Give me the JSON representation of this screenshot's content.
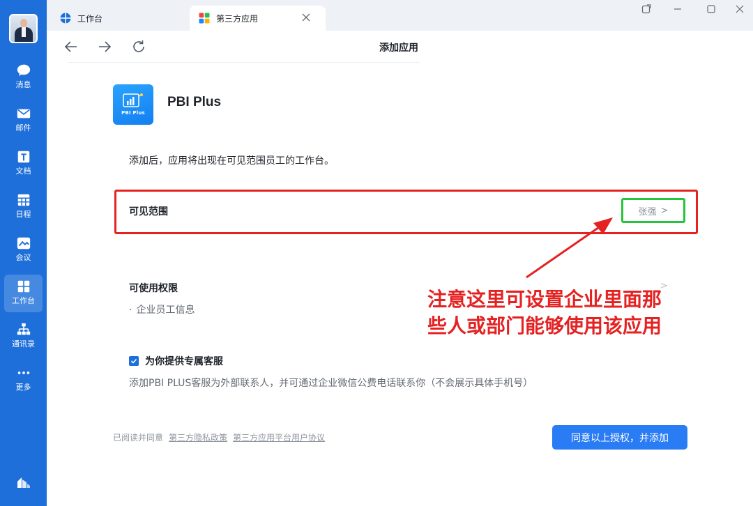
{
  "sidebar": {
    "items": [
      {
        "label": "消息",
        "icon": "chat-bubble-icon"
      },
      {
        "label": "邮件",
        "icon": "mail-icon"
      },
      {
        "label": "文档",
        "icon": "document-icon"
      },
      {
        "label": "日程",
        "icon": "calendar-icon"
      },
      {
        "label": "会议",
        "icon": "meeting-icon"
      },
      {
        "label": "工作台",
        "icon": "grid-icon"
      },
      {
        "label": "通讯录",
        "icon": "contacts-icon"
      },
      {
        "label": "更多",
        "icon": "more-icon"
      }
    ],
    "active_index": 5
  },
  "tabs": [
    {
      "label": "工作台",
      "icon": "workbench-icon"
    },
    {
      "label": "第三方应用",
      "icon": "third-party-apps-icon"
    }
  ],
  "header": {
    "title": "添加应用"
  },
  "app": {
    "name": "PBI Plus",
    "logo_text": "PBI Plus"
  },
  "intro_text": "添加后，应用将出现在可见范围员工的工作台。",
  "visibility": {
    "label": "可见范围",
    "value": "张强",
    "chevron": ">"
  },
  "permissions": {
    "label": "可使用权限",
    "chevron": ">",
    "items": [
      "企业员工信息"
    ]
  },
  "annotation": {
    "line1": "注意这里可设置企业里面那",
    "line2": "些人或部门能够使用该应用"
  },
  "service": {
    "checked": true,
    "label": "为你提供专属客服",
    "description": "添加PBI PLUS客服为外部联系人，并可通过企业微信公费电话联系你（不会展示具体手机号）"
  },
  "footer": {
    "prefix": "已阅读并同意",
    "links": [
      "第三方隐私政策",
      "第三方应用平台用户协议"
    ]
  },
  "primary_button": {
    "label": "同意以上授权，并添加"
  },
  "colors": {
    "sidebar": "#1e6fd9",
    "primary": "#2a7cf5",
    "highlight_red": "#e52222",
    "highlight_green": "#26c43a"
  }
}
